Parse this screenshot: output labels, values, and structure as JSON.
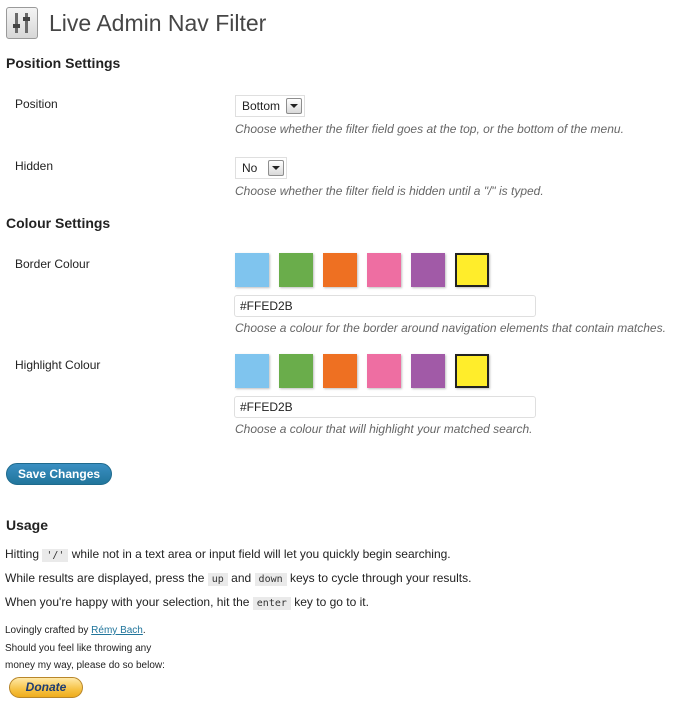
{
  "page": {
    "title": "Live Admin Nav Filter"
  },
  "position_settings": {
    "heading": "Position Settings",
    "position": {
      "label": "Position",
      "value": "Bottom",
      "description": "Choose whether the filter field goes at the top, or the bottom of the menu."
    },
    "hidden": {
      "label": "Hidden",
      "value": "No",
      "description": "Choose whether the filter field is hidden until a \"/\" is typed."
    }
  },
  "colour_settings": {
    "heading": "Colour Settings",
    "swatch_colors": [
      "#7fc4ee",
      "#6aad4b",
      "#ee7022",
      "#ee6ea2",
      "#a15aa7",
      "#ffed2b"
    ],
    "border": {
      "label": "Border Colour",
      "value": "#FFED2B",
      "description": "Choose a colour for the border around navigation elements that contain matches."
    },
    "highlight": {
      "label": "Highlight Colour",
      "value": "#FFED2B",
      "description": "Choose a colour that will highlight your matched search."
    }
  },
  "save_button": "Save Changes",
  "usage": {
    "heading": "Usage",
    "line1": {
      "before": "Hitting",
      "key": "'/'",
      "after": "while not in a text area or input field will let you quickly begin searching."
    },
    "line2": {
      "before": "While results are displayed, press the",
      "key1": "up",
      "mid": "and",
      "key2": "down",
      "after": "keys to cycle through your results."
    },
    "line3": {
      "before": "When you're happy with your selection, hit the",
      "key": "enter",
      "after": "key to go to it."
    }
  },
  "credit": {
    "prefix": "Lovingly crafted by",
    "author": "Rémy Bach",
    "suffix": ".",
    "line2": "Should you feel like throwing any",
    "line3": "money my way, please do so below:"
  },
  "donate_button": "Donate"
}
